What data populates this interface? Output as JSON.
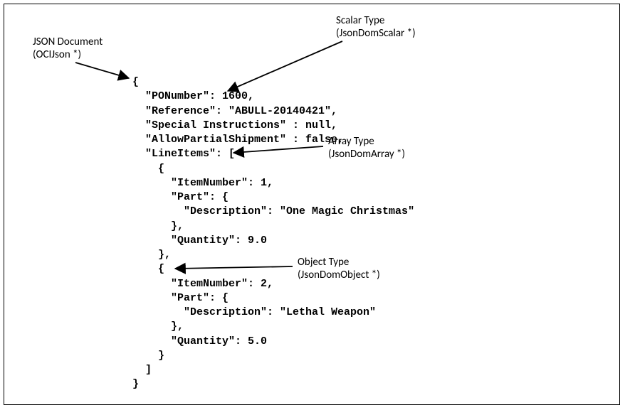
{
  "labels": {
    "jsondoc": "JSON Document\n(OCIJson *)",
    "scalar": "Scalar Type\n(JsonDomScalar *)",
    "array": "Array Type\n(JsonDomArray *)",
    "object": "Object Type\n(JsonDomObject *)"
  },
  "code": "{\n  \"PONumber\": 1600,\n  \"Reference\": \"ABULL-20140421\",\n  \"Special Instructions\" : null,\n  \"AllowPartialShipment\" : false,\n  \"LineItems\": [\n    {\n      \"ItemNumber\": 1,\n      \"Part\": {\n        \"Description\": \"One Magic Christmas\"\n      },\n      \"Quantity\": 9.0\n    },\n    {\n      \"ItemNumber\": 2,\n      \"Part\": {\n        \"Description\": \"Lethal Weapon\"\n      },\n      \"Quantity\": 5.0\n    }\n  ]\n}"
}
